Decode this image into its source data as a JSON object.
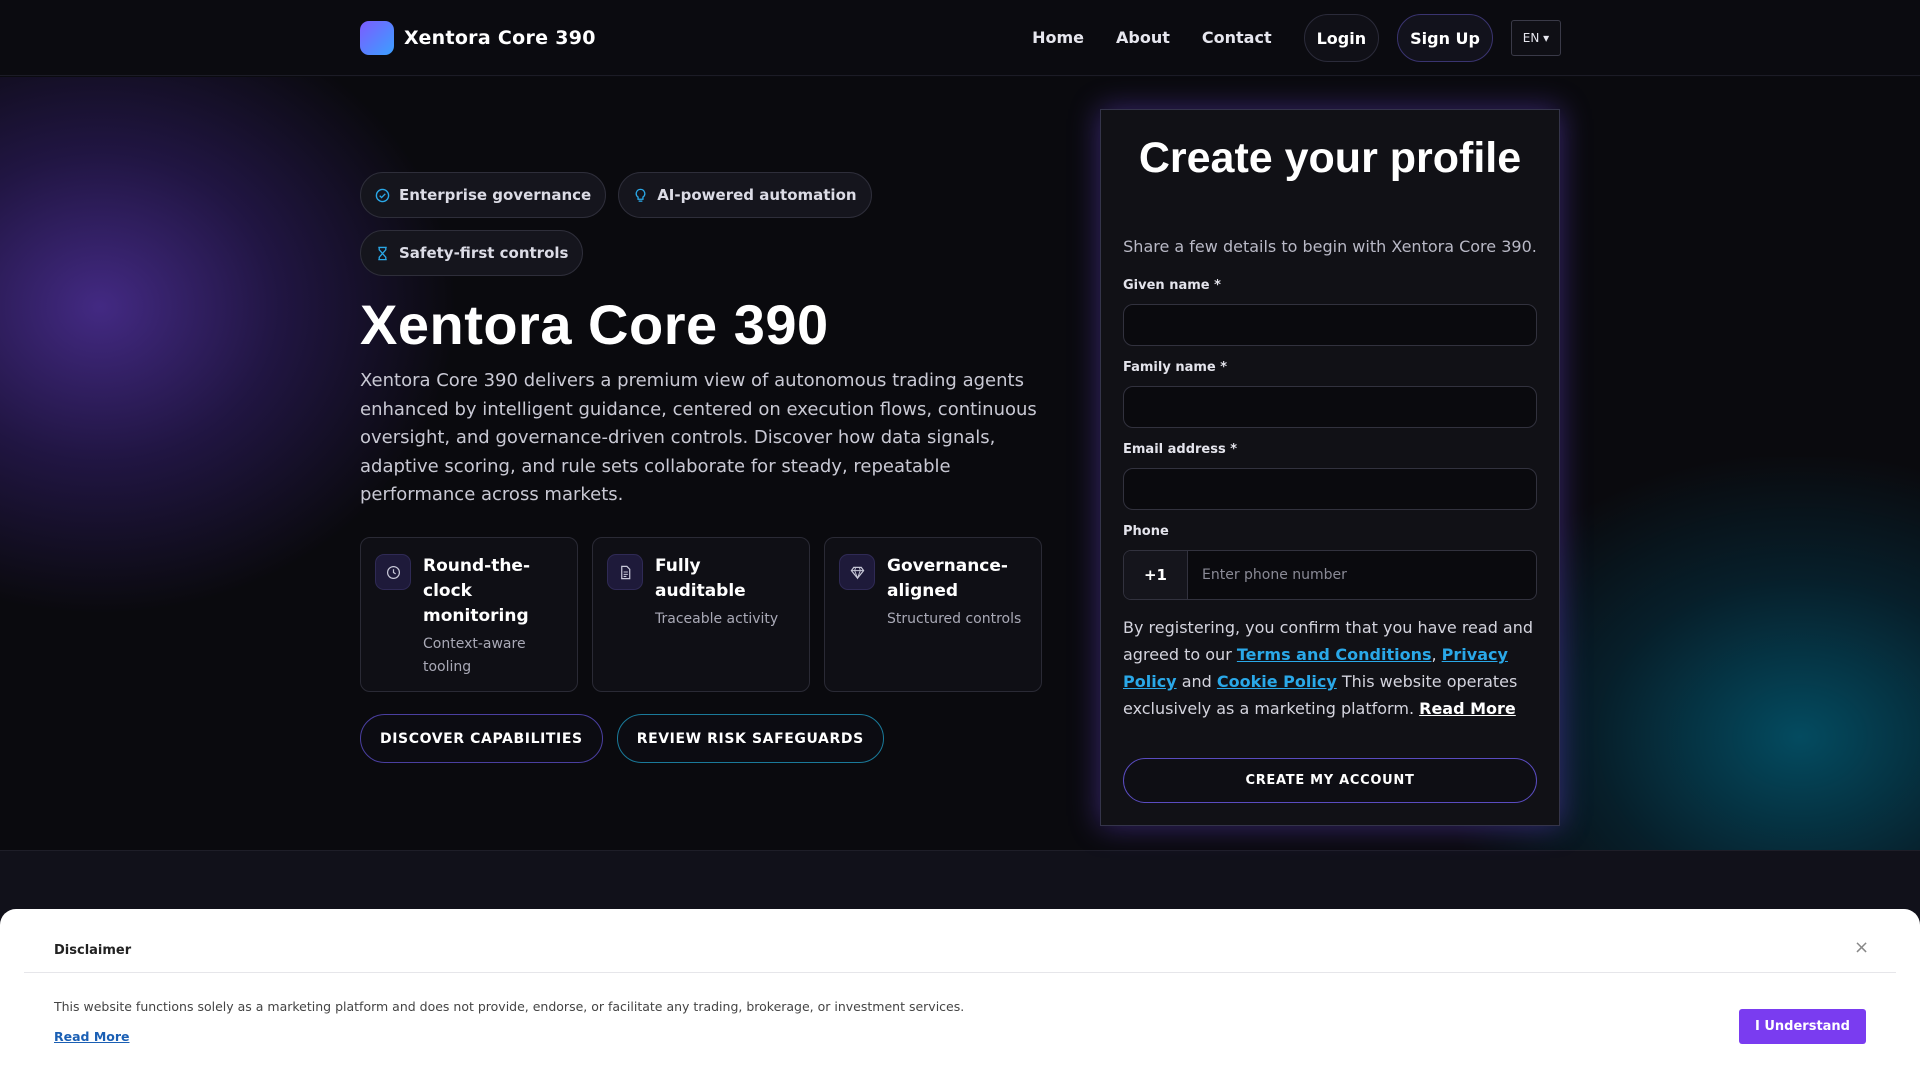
{
  "header": {
    "brand_name": "Xentora Core 390",
    "nav": [
      "Home",
      "About",
      "Contact"
    ],
    "login_label": "Login",
    "signup_label": "Sign Up",
    "language": "EN ▾"
  },
  "hero": {
    "badges": [
      "Enterprise governance",
      "AI-powered automation",
      "Safety-first controls"
    ],
    "title": "Xentora Core 390",
    "description": "Xentora Core 390 delivers a premium view of autonomous trading agents enhanced by intelligent guidance, centered on execution flows, continuous oversight, and governance-driven controls. Discover how data signals, adaptive scoring, and rule sets collaborate for steady, repeatable performance across markets.",
    "features": [
      {
        "title": "Round-the-clock monitoring",
        "subtitle": "Context-aware tooling",
        "icon": "clock-icon"
      },
      {
        "title": "Fully auditable",
        "subtitle": "Traceable activity",
        "icon": "document-icon"
      },
      {
        "title": "Governance-aligned",
        "subtitle": "Structured controls",
        "icon": "gem-icon"
      }
    ],
    "cta_primary": "DISCOVER CAPABILITIES",
    "cta_secondary": "REVIEW RISK SAFEGUARDS"
  },
  "form": {
    "title": "Create your profile",
    "subtitle": "Share a few details to begin with Xentora Core 390.",
    "given_name_label": "Given name *",
    "family_name_label": "Family name *",
    "email_label": "Email address *",
    "phone_label": "Phone",
    "phone_code": "+1",
    "phone_placeholder": "Enter phone number",
    "legal_prefix": "By registering, you confirm that you have read and agreed to our",
    "terms_link": "Terms and Conditions",
    "privacy_link": "Privacy Policy",
    "and_text": "and",
    "cookie_link": "Cookie Policy",
    "legal_suffix": "This website operates exclusively as a marketing platform.",
    "read_more": "Read More",
    "submit_label": "CREATE MY ACCOUNT"
  },
  "disclaimer": {
    "title": "Disclaimer",
    "close": "×",
    "text": "This website functions solely as a marketing platform and does not provide, endorse, or facilitate any trading, brokerage, or investment services.",
    "read_more": "Read More",
    "button": "I Understand"
  },
  "colors": {
    "accent_purple": "#7a3cf0",
    "link_blue": "#2aa8e8",
    "background": "#0b0b10"
  }
}
